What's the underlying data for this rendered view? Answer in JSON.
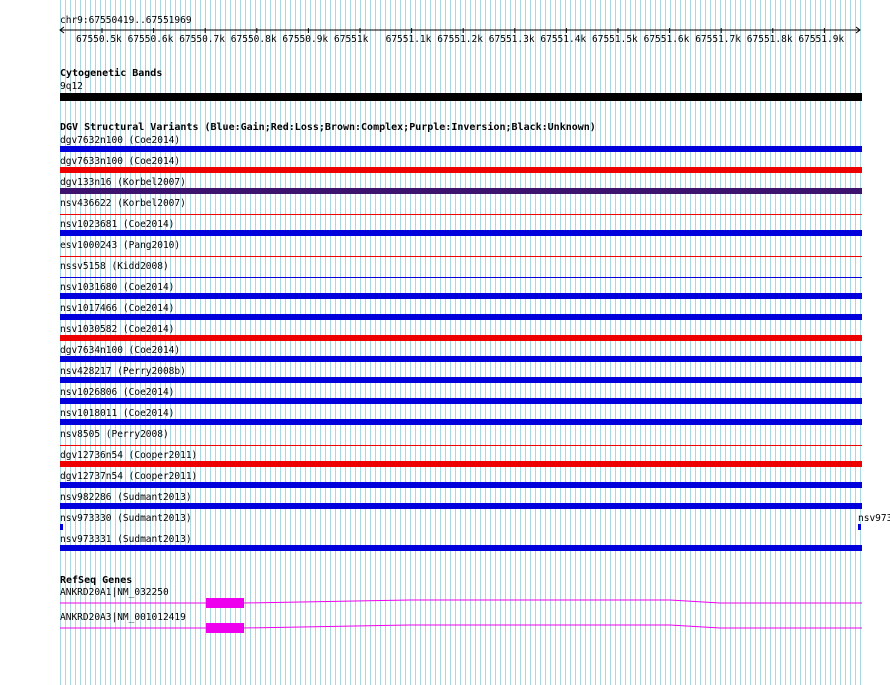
{
  "ruler": {
    "position": "chr9:67550419..67551969",
    "ticks": [
      "67550.5k",
      "67550.6k",
      "67550.7k",
      "67550.8k",
      "67550.9k",
      "67551k",
      "67551.1k",
      "67551.2k",
      "67551.3k",
      "67551.4k",
      "67551.5k",
      "67551.6k",
      "67551.7k",
      "67551.8k",
      "67551.9k"
    ]
  },
  "colors": {
    "gain": "#0000dd",
    "loss": "#ee0000",
    "inversion": "#3c1470",
    "band": "#000000",
    "gene": "#ee00ee"
  },
  "cytoband": {
    "title": "Cytogenetic Bands",
    "label": "9q12"
  },
  "dgv": {
    "title": "DGV Structural Variants (Blue:Gain;Red:Loss;Brown:Complex;Purple:Inversion;Black:Unknown)",
    "items": [
      {
        "label": "dgv7632n100 (Coe2014)",
        "color": "#0000dd",
        "thin": false
      },
      {
        "label": "dgv7633n100 (Coe2014)",
        "color": "#ee0000",
        "thin": false
      },
      {
        "label": "dgv133n16 (Korbel2007)",
        "color": "#3c1470",
        "thin": false
      },
      {
        "label": "nsv436622 (Korbel2007)",
        "color": "#ee0000",
        "thin": true
      },
      {
        "label": "nsv1023681 (Coe2014)",
        "color": "#0000dd",
        "thin": false
      },
      {
        "label": "esv1000243 (Pang2010)",
        "color": "#ee0000",
        "thin": true
      },
      {
        "label": "nssv5158 (Kidd2008)",
        "color": "#0000dd",
        "thin": true
      },
      {
        "label": "nsv1031680 (Coe2014)",
        "color": "#0000dd",
        "thin": false
      },
      {
        "label": "nsv1017466 (Coe2014)",
        "color": "#0000dd",
        "thin": false
      },
      {
        "label": "nsv1030582 (Coe2014)",
        "color": "#ee0000",
        "thin": false
      },
      {
        "label": "dgv7634n100 (Coe2014)",
        "color": "#0000dd",
        "thin": false
      },
      {
        "label": "nsv428217 (Perry2008b)",
        "color": "#0000dd",
        "thin": false
      },
      {
        "label": "nsv1026806 (Coe2014)",
        "color": "#0000dd",
        "thin": false
      },
      {
        "label": "nsv1018011 (Coe2014)",
        "color": "#0000dd",
        "thin": false
      },
      {
        "label": "nsv8505 (Perry2008)",
        "color": "#ee0000",
        "thin": true
      },
      {
        "label": "dgv12736n54 (Cooper2011)",
        "color": "#ee0000",
        "thin": false
      },
      {
        "label": "dgv12737n54 (Cooper2011)",
        "color": "#0000dd",
        "thin": false
      },
      {
        "label": "nsv982286 (Sudmant2013)",
        "color": "#0000dd",
        "thin": false
      },
      {
        "label": "nsv973330 (Sudmant2013)",
        "color": "#0000dd",
        "thin": false,
        "split": true,
        "right_label": "nsv973"
      },
      {
        "label": "nsv973331 (Sudmant2013)",
        "color": "#0000dd",
        "thin": false
      }
    ]
  },
  "refseq": {
    "title": "RefSeq Genes",
    "genes": [
      {
        "label": "ANKRD20A1|NM_032250"
      },
      {
        "label": "ANKRD20A3|NM_001012419"
      }
    ]
  }
}
